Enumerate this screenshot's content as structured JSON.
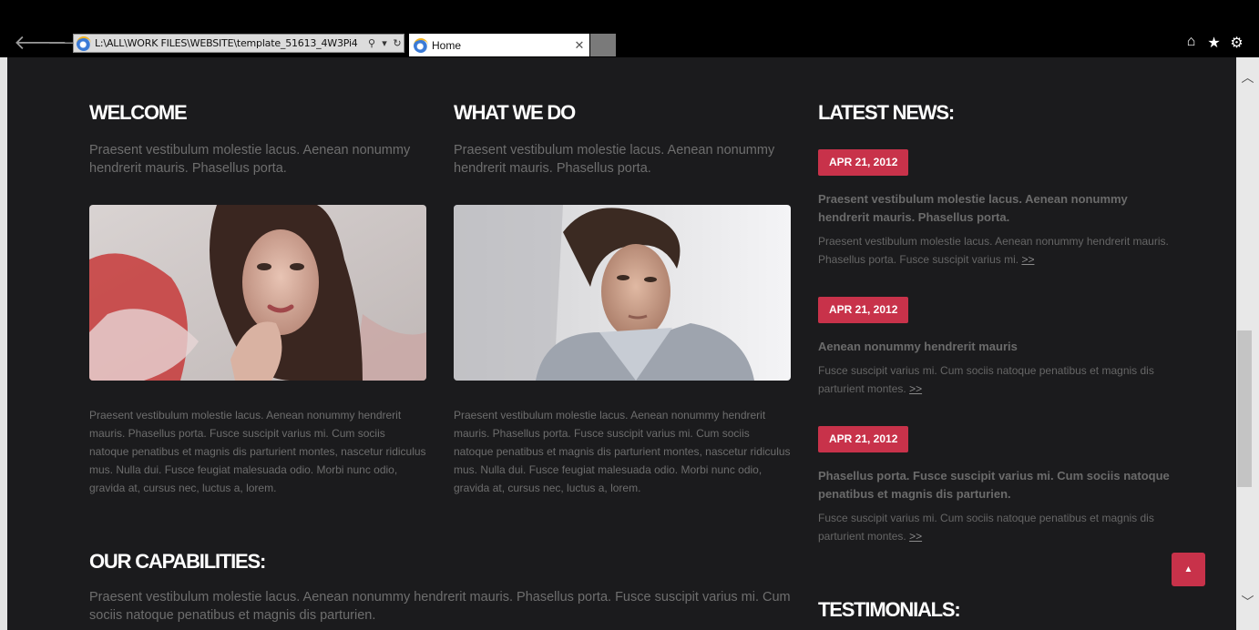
{
  "browser": {
    "address": "L:\\ALL\\WORK FILES\\WEBSITE\\template_51613_4W3Pi4",
    "tab_title": "Home",
    "back_glyph": "🡐",
    "forward_glyph": "🡒",
    "search_glyph": "⚲",
    "dropdown_glyph": "▾",
    "refresh_glyph": "↻",
    "close_glyph": "✕",
    "home_glyph": "⌂",
    "favorites_glyph": "★",
    "settings_glyph": "⚙"
  },
  "welcome": {
    "heading": "WELCOME",
    "intro": "Praesent vestibulum molestie lacus. Aenean nonummy hendrerit mauris. Phasellus porta.",
    "text": "Praesent vestibulum molestie lacus. Aenean nonummy hendrerit mauris. Phasellus porta. Fusce suscipit varius mi. Cum sociis natoque penatibus et magnis dis parturient montes, nascetur ridiculus mus. Nulla dui. Fusce feugiat malesuada odio. Morbi nunc odio, gravida at, cursus nec, luctus a, lorem."
  },
  "what_we_do": {
    "heading": "WHAT WE DO",
    "intro": "Praesent vestibulum molestie lacus. Aenean nonummy hendrerit mauris. Phasellus porta.",
    "text": "Praesent vestibulum molestie lacus. Aenean nonummy hendrerit mauris. Phasellus porta. Fusce suscipit varius mi. Cum sociis natoque penatibus et magnis dis parturient montes, nascetur ridiculus mus. Nulla dui. Fusce feugiat malesuada odio. Morbi nunc odio, gravida at, cursus nec, luctus a, lorem."
  },
  "news": {
    "heading": "LATEST NEWS:",
    "more_label": ">>",
    "items": [
      {
        "date": "APR 21, 2012",
        "title": "Praesent vestibulum molestie lacus. Aenean nonummy hendrerit mauris. Phasellus porta.",
        "text": "Praesent vestibulum molestie lacus. Aenean nonummy hendrerit mauris. Phasellus porta. Fusce suscipit varius mi."
      },
      {
        "date": "APR 21, 2012",
        "title": "Aenean nonummy hendrerit mauris",
        "text": "Fusce suscipit varius mi. Cum sociis natoque penatibus et magnis dis parturient montes."
      },
      {
        "date": "APR 21, 2012",
        "title": "Phasellus porta. Fusce suscipit varius mi. Cum sociis natoque penatibus et magnis dis parturien.",
        "text": "Fusce suscipit varius mi. Cum sociis natoque penatibus et magnis dis parturient montes."
      }
    ]
  },
  "capabilities": {
    "heading": "OUR CAPABILITIES:",
    "intro": "Praesent vestibulum molestie lacus. Aenean nonummy hendrerit mauris. Phasellus porta. Fusce suscipit varius mi. Cum sociis natoque penatibus et magnis dis parturien."
  },
  "testimonials": {
    "heading": "TESTIMONIALS:"
  },
  "to_top_glyph": "▲",
  "scroll_up_glyph": "︿",
  "scroll_down_glyph": "﹀",
  "colors": {
    "background": "#1b1b1d",
    "accent": "#c8324a",
    "heading": "#ffffff",
    "body_text": "#6d6d6d"
  }
}
